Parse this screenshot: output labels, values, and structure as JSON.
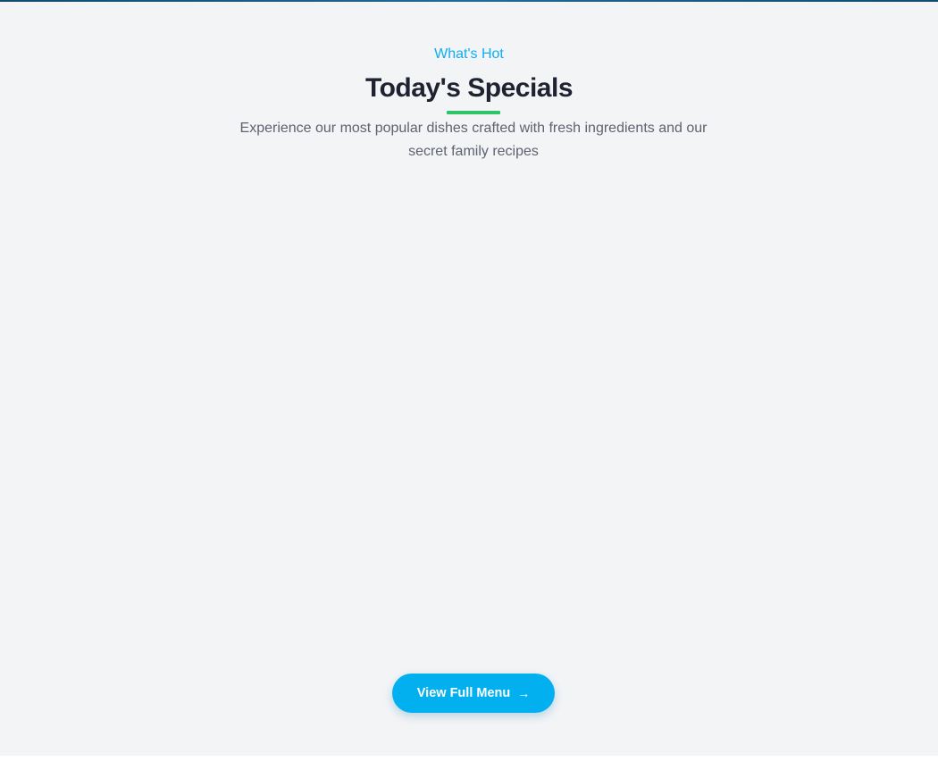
{
  "section": {
    "eyebrow": "What's Hot",
    "title": "Today's Specials",
    "description": "Experience our most popular dishes crafted with fresh ingredients and our secret family recipes",
    "button_label": "View Full Menu",
    "button_icon": "arrow-right-icon"
  },
  "colors": {
    "accent": "#02b0f0",
    "underline": "#2ec56a",
    "title": "#1f2230",
    "background": "#f3f4f6"
  }
}
